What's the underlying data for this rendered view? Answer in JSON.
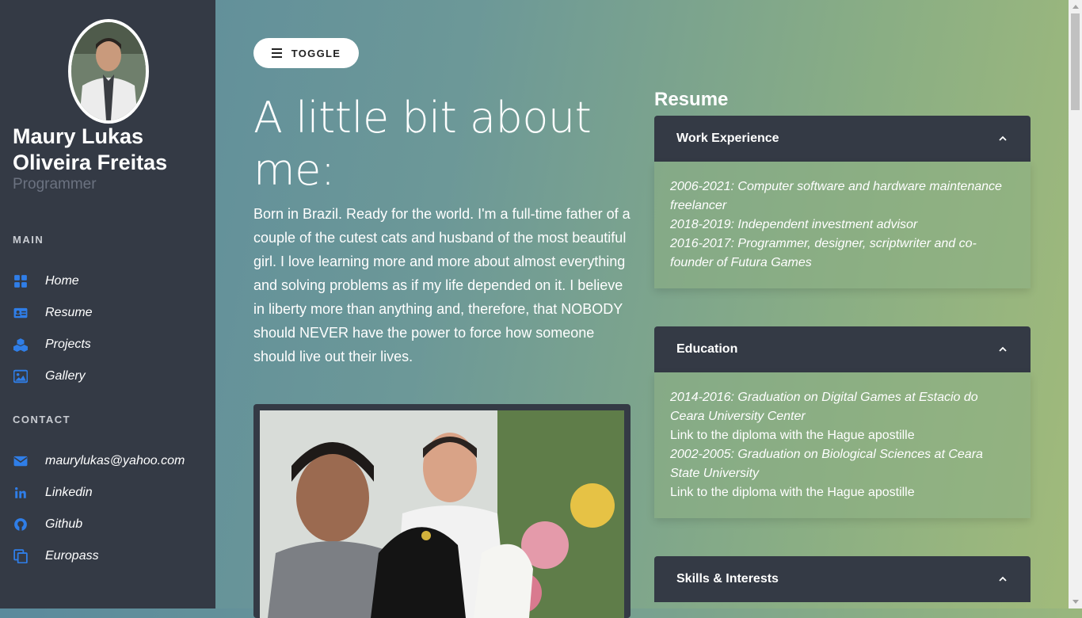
{
  "sidebar": {
    "name": "Maury Lukas Oliveira Freitas",
    "role": "Programmer",
    "main_title": "MAIN",
    "main_items": [
      {
        "label": "Home",
        "icon": "grid-icon"
      },
      {
        "label": "Resume",
        "icon": "id-card-icon"
      },
      {
        "label": "Projects",
        "icon": "cubes-icon"
      },
      {
        "label": "Gallery",
        "icon": "image-icon"
      }
    ],
    "contact_title": "CONTACT",
    "contact_items": [
      {
        "label": "maurylukas@yahoo.com",
        "icon": "envelope-icon"
      },
      {
        "label": "Linkedin",
        "icon": "linkedin-icon"
      },
      {
        "label": "Github",
        "icon": "github-icon"
      },
      {
        "label": "Europass",
        "icon": "copy-icon"
      }
    ],
    "accent": "#2f7ee8"
  },
  "main": {
    "toggle_label": "TOGGLE",
    "headline": "A little bit about me:",
    "about": "Born in Brazil. Ready for the world. I'm a full-time father of a couple of the cutest cats and husband of the most beautiful girl. I love learning more and more about almost everything and solving problems as if my life depended on it. I believe in liberty more than anything and, therefore, that NOBODY should NEVER have the power to force how someone should live out their lives."
  },
  "resume": {
    "title": "Resume",
    "work": {
      "title": "Work Experience",
      "lines": [
        "2006-2021: Computer software and hardware maintenance freelancer",
        "2018-2019: Independent investment advisor",
        "2016-2017: Programmer, designer, scriptwriter and co-founder of Futura Games"
      ]
    },
    "education": {
      "title": "Education",
      "lines": [
        "2014-2016: Graduation on Digital Games at Estacio do Ceara University Center",
        "Link to the diploma with the Hague apostille",
        "2002-2005: Graduation on Biological Sciences at Ceara State University",
        "Link to the diploma with the Hague apostille"
      ]
    },
    "skills": {
      "title": "Skills & Interests"
    }
  }
}
